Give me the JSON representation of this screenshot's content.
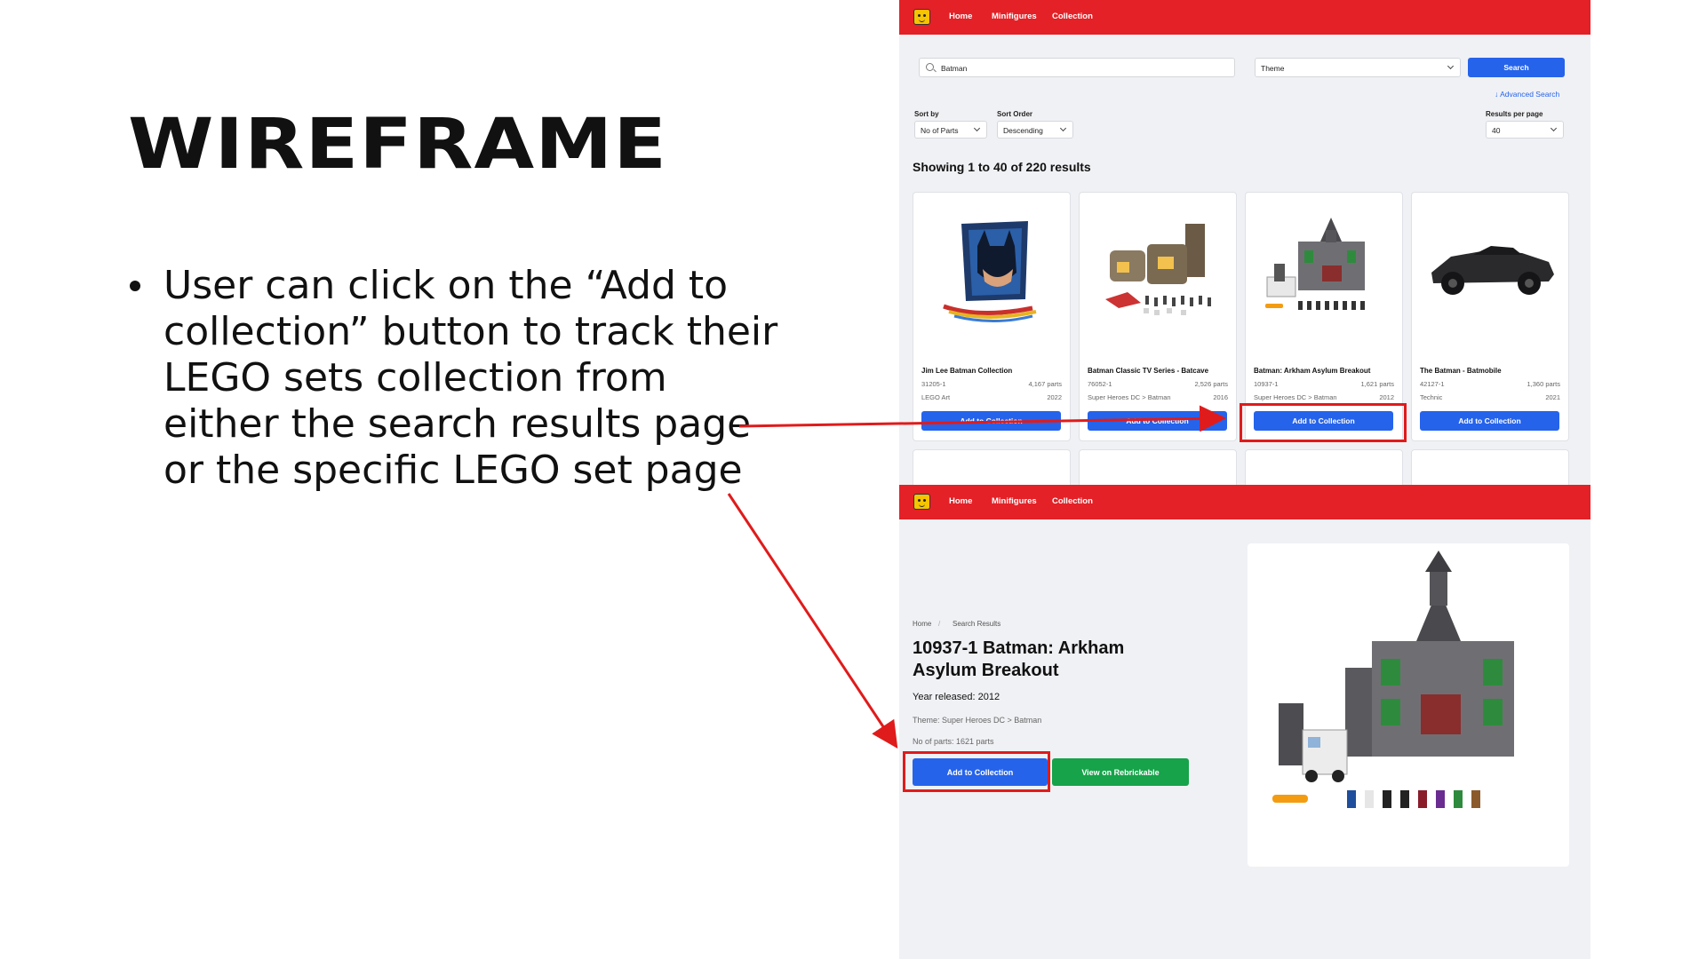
{
  "slide": {
    "title": "WIREFRAME",
    "bullet": "User can click on the “Add to collection” button to track their LEGO sets collection from either the search results page or the specific LEGO set page"
  },
  "nav": {
    "logo_icon": "lego-head-icon",
    "links": [
      "Home",
      "Minifigures",
      "Collection"
    ]
  },
  "search": {
    "query": "Batman",
    "theme": "Theme",
    "search_button": "Search",
    "advanced_link": "↓ Advanced Search",
    "sort_by_label": "Sort by",
    "sort_by_value": "No of Parts",
    "sort_order_label": "Sort Order",
    "sort_order_value": "Descending",
    "per_page_label": "Results per page",
    "per_page_value": "40",
    "results_heading": "Showing 1 to 40 of 220 results"
  },
  "results": [
    {
      "name": "Jim Lee Batman Collection",
      "set_num": "31205-1",
      "parts": "4,167 parts",
      "theme": "LEGO Art",
      "year": "2022",
      "button": "Add to Collection"
    },
    {
      "name": "Batman Classic TV Series - Batcave",
      "set_num": "76052-1",
      "parts": "2,526 parts",
      "theme": "Super Heroes DC > Batman",
      "year": "2016",
      "button": "Add to Collection"
    },
    {
      "name": "Batman: Arkham Asylum Breakout",
      "set_num": "10937-1",
      "parts": "1,621 parts",
      "theme": "Super Heroes DC > Batman",
      "year": "2012",
      "button": "Add to Collection"
    },
    {
      "name": "The Batman - Batmobile",
      "set_num": "42127-1",
      "parts": "1,360 parts",
      "theme": "Technic",
      "year": "2021",
      "button": "Add to Collection"
    }
  ],
  "detail": {
    "breadcrumb": [
      "Home",
      "Search Results"
    ],
    "title": "10937-1 Batman: Arkham Asylum Breakout",
    "year": "Year released: 2012",
    "theme": "Theme: Super Heroes DC > Batman",
    "parts": "No of parts: 1621 parts",
    "add_button": "Add to Collection",
    "rebrickable_button": "View on Rebrickable"
  },
  "colors": {
    "nav_red": "#e32127",
    "primary_blue": "#2563eb",
    "green": "#16a34a",
    "annotation_red": "#e01b1b"
  }
}
